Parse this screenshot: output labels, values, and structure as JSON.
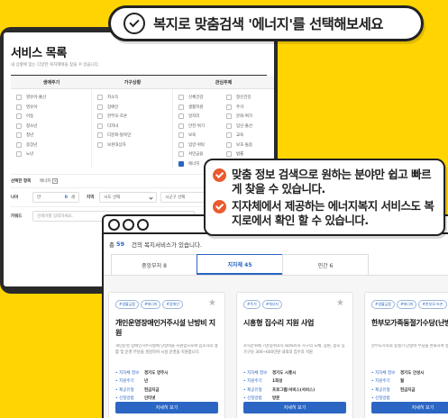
{
  "banner": {
    "text": "복지로 맞춤검색 '에너지'를 선택해보세요"
  },
  "back_window": {
    "title": "서비스 목록",
    "subtitle": "내 상황에 맞는 다양한 복지혜택을 찾을 수 있습니다.",
    "filter_columns": [
      {
        "header": "생애주기",
        "items": [
          "영유아·출산",
          "영유아",
          "아동",
          "청소년",
          "청년",
          "중장년",
          "노년"
        ]
      },
      {
        "header": "가구상황",
        "items": [
          "저소득",
          "장애인",
          "한부모·조손",
          "다자녀",
          "다문화·탈북민",
          "보훈대상자"
        ]
      },
      {
        "header": "관심주제",
        "items": [
          "신체건강",
          "정신건강",
          "생활지원",
          "주거",
          "일자리",
          "문화·여가",
          "안전·위기",
          "임신·출산",
          "보육",
          "교육",
          "입양·위탁",
          "보호·돌봄",
          "서민금융",
          "법률",
          "에너지"
        ],
        "checked": "에너지"
      }
    ],
    "selected_label": "선택한 항목",
    "selected_chip": "에너지",
    "age_label": "나이",
    "age_prefix": "만",
    "age_value": "0",
    "age_unit": "세",
    "region_label": "지역",
    "region_select": "시도 선택",
    "district_select": "시군구 선택",
    "keyword_label": "키워드",
    "keyword_placeholder": "검색어를 입력하세요."
  },
  "callout": {
    "lines": [
      "맞춤 정보 검색으로 원하는 분야만 쉽고 빠르게 찾을 수 있습니다.",
      "지자체에서 제공하는 에너지복지 서비스도 복지로에서 확인 할 수 있습니다."
    ]
  },
  "results": {
    "prefix": "총",
    "count": "59",
    "suffix": "건의 복지서비스가 있습니다.",
    "tabs": [
      {
        "label": "중앙부처 8"
      },
      {
        "label": "지자체 45"
      },
      {
        "label": "민간 6"
      }
    ],
    "active_tab": "지자체 45",
    "cards": [
      {
        "tags": [
          "#생활금융",
          "#에너지",
          "#장애인"
        ],
        "title": "개인운영장애인거주시설 난방비 지원",
        "desc": "개인운영 장애인거주시설에 난방비를 지원함으로써 입소자의 생활 및 운영 부담을 경감하여 시설 운영을 지원합니다.",
        "info": [
          {
            "k": "지자체 정보",
            "v": "경기도 양주시"
          },
          {
            "k": "지원주기",
            "v": "년"
          },
          {
            "k": "제공유형",
            "v": "현금지급"
          },
          {
            "k": "신청방법",
            "v": "인터넷"
          }
        ],
        "button": "자세히 보기"
      },
      {
        "tags": [
          "#주거",
          "#에너지"
        ],
        "title": "시흥형 집수리 지원 사업",
        "desc": "소득분위에 기준중위소득 60%이하 가구의 도배, 장판, 창호 등 가구당 300~600만원 내외의 집수리 지원",
        "info": [
          {
            "k": "지자체 정보",
            "v": "경기도 시흥시"
          },
          {
            "k": "지원주기",
            "v": "1회성"
          },
          {
            "k": "제공유형",
            "v": "프로그램/서비스(서비스)"
          },
          {
            "k": "신청방법",
            "v": "방문"
          }
        ],
        "button": "자세히 보기"
      },
      {
        "tags": [
          "#생활금융",
          "#에너지",
          "#한부모·조손"
        ],
        "title": "한부모가족동절기수당(난방비)",
        "desc": "한부모가족의 동절기 난방비 부담을 완화하여 생활 안정 도모",
        "info": [
          {
            "k": "지자체 정보",
            "v": "경기도 안성시"
          },
          {
            "k": "지원주기",
            "v": "월"
          },
          {
            "k": "제공유형",
            "v": "현금지급"
          },
          {
            "k": "신청방법",
            "v": ""
          }
        ],
        "button": "자세히 보기"
      }
    ]
  },
  "colors": {
    "background": "#FFD400",
    "accent": "#2b66c4",
    "heart": "#e85b2e"
  }
}
